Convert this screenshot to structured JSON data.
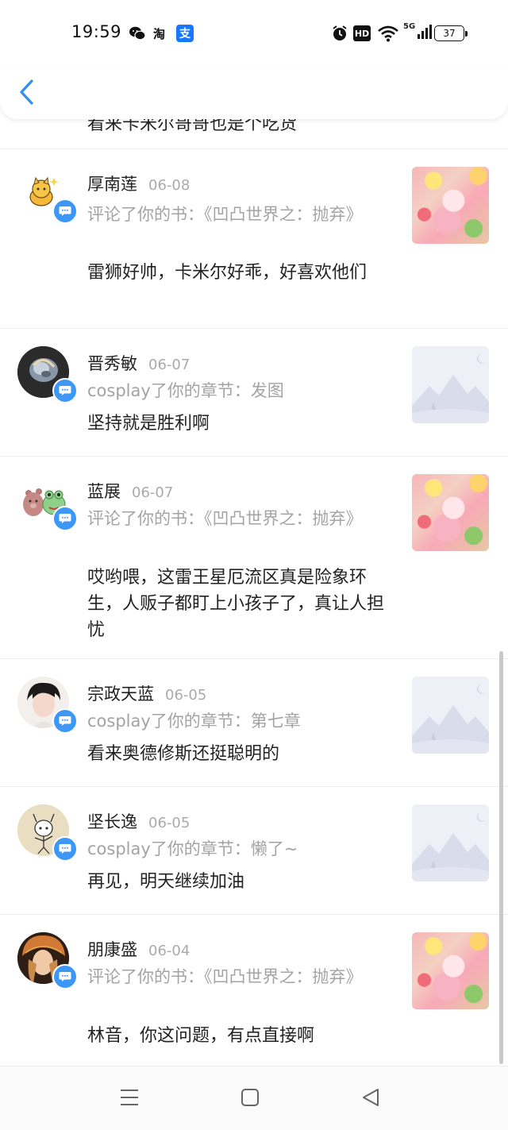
{
  "status_bar": {
    "time": "19:59",
    "notification_icons": [
      "wechat-icon",
      "taobao-icon",
      "alipay-icon"
    ],
    "taobao_glyph": "淘",
    "alipay_glyph": "支",
    "system_icons": [
      "alarm-icon",
      "hd-icon",
      "wifi-icon",
      "5g-signal-icon",
      "battery-icon"
    ],
    "hd_label": "HD",
    "network_label": "5G",
    "battery": "37"
  },
  "header": {
    "back_icon": "chevron-left-icon"
  },
  "partial_item": {
    "content": "看来卡米尔哥哥也是个吃货"
  },
  "items": [
    {
      "name": "厚南莲",
      "date": "06-08",
      "sub": "评论了你的书：《凹凸世界之：抛弃》",
      "content": "雷狮好帅，卡米尔好乖，好喜欢他们",
      "thumb": "book-cover"
    },
    {
      "name": "晋秀敏",
      "date": "06-07",
      "sub": "cosplay了你的章节：发图",
      "content": "坚持就是胜利啊",
      "thumb": "image-placeholder"
    },
    {
      "name": "蓝展",
      "date": "06-07",
      "sub": "评论了你的书：《凹凸世界之：抛弃》",
      "content": "哎哟喂，这雷王星厄流区真是险象环生，人贩子都盯上小孩子了，真让人担忧",
      "thumb": "book-cover"
    },
    {
      "name": "宗政天蓝",
      "date": "06-05",
      "sub": "cosplay了你的章节：第七章",
      "content": "看来奥德修斯还挺聪明的",
      "thumb": "image-placeholder"
    },
    {
      "name": "坚长逸",
      "date": "06-05",
      "sub": "cosplay了你的章节：懒了~",
      "content": "再见，明天继续加油",
      "thumb": "image-placeholder"
    },
    {
      "name": "朋康盛",
      "date": "06-04",
      "sub": "评论了你的书：《凹凸世界之：抛弃》",
      "content": "林音，你这问题，有点直接啊",
      "thumb": "book-cover"
    }
  ],
  "badge_icon": "comment-bubble-icon",
  "nav": [
    "menu-icon",
    "home-square-icon",
    "back-triangle-icon"
  ],
  "colors": {
    "accent": "#3d97f6",
    "muted_text": "#a3a3a3",
    "divider": "#ededed"
  }
}
